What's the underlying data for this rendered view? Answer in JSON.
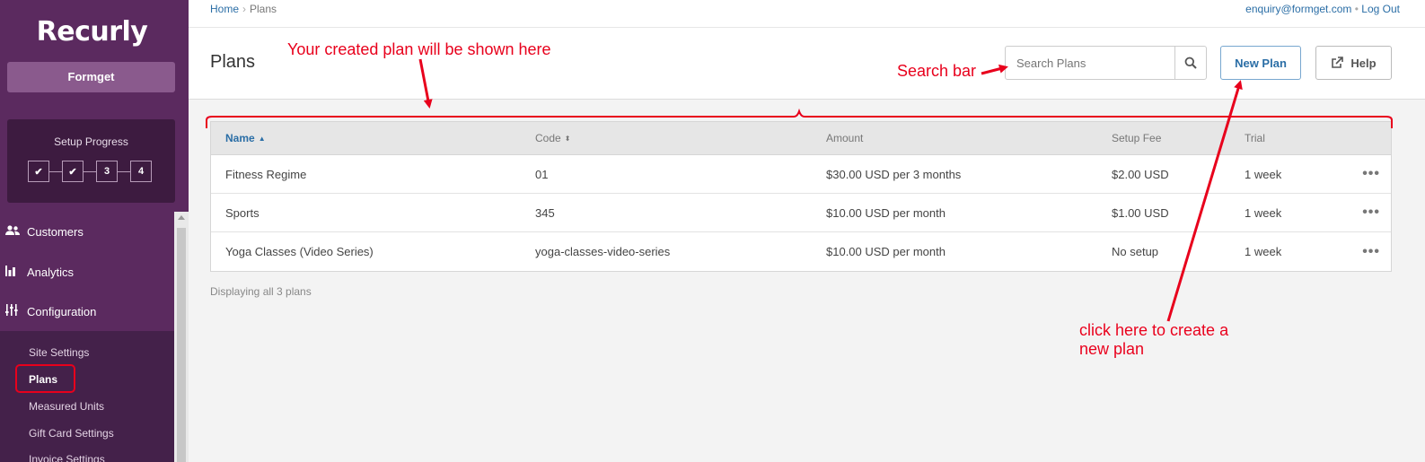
{
  "brand": {
    "logo": "Recurly",
    "site_name": "Formget"
  },
  "setup": {
    "title": "Setup Progress",
    "steps": [
      "✔",
      "✔",
      "3",
      "4"
    ]
  },
  "nav": {
    "customers": "Customers",
    "analytics": "Analytics",
    "configuration": "Configuration",
    "sub": [
      "Site Settings",
      "Plans",
      "Measured Units",
      "Gift Card Settings",
      "Invoice Settings"
    ]
  },
  "breadcrumb": {
    "home": "Home",
    "current": "Plans"
  },
  "user": {
    "email": "enquiry@formget.com",
    "separator": "•",
    "logout": "Log Out"
  },
  "page": {
    "title": "Plans"
  },
  "search": {
    "placeholder": "Search Plans"
  },
  "buttons": {
    "new_plan": "New Plan",
    "help": "Help"
  },
  "table": {
    "headers": {
      "name": "Name",
      "code": "Code",
      "amount": "Amount",
      "setup_fee": "Setup Fee",
      "trial": "Trial"
    },
    "rows": [
      {
        "name": "Fitness Regime",
        "code": "01",
        "amount": "$30.00 USD per 3 months",
        "setup_fee": "$2.00 USD",
        "trial": "1 week",
        "more": "•••"
      },
      {
        "name": "Sports",
        "code": "345",
        "amount": "$10.00 USD per month",
        "setup_fee": "$1.00 USD",
        "trial": "1 week",
        "more": "•••"
      },
      {
        "name": "Yoga Classes (Video Series)",
        "code": "yoga-classes-video-series",
        "amount": "$10.00 USD per month",
        "setup_fee": "No setup",
        "trial": "1 week",
        "more": "•••"
      }
    ],
    "footer": "Displaying all 3 plans"
  },
  "annotations": {
    "created_plan": "Your created plan will be shown here",
    "search_bar": "Search bar",
    "new_plan_line1": "click here to create a",
    "new_plan_line2": "new plan",
    "color": "#e8001c"
  },
  "colors": {
    "sidebar": "#5b2a5f",
    "link": "#2b6ea6",
    "annotation": "#e8001c"
  }
}
